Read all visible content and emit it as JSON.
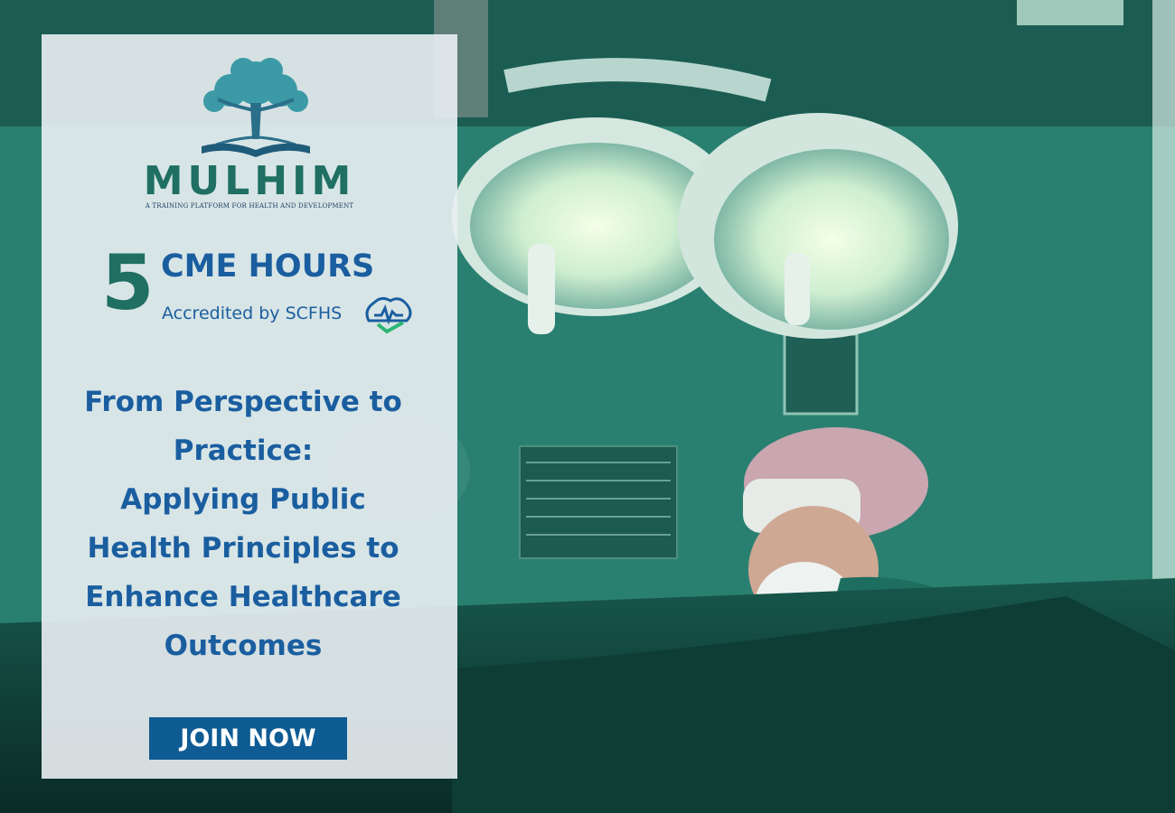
{
  "brand": {
    "name": "MULHIM",
    "tagline": "A TRAINING PLATFORM FOR HEALTH AND DEVELOPMENT"
  },
  "cme": {
    "number": "5",
    "label": "CME HOURS",
    "accreditation": "Accredited by SCFHS"
  },
  "course": {
    "title_lines": [
      "From Perspective to",
      "Practice:",
      "Applying Public",
      "Health Principles to",
      "Enhance Healthcare",
      "Outcomes"
    ]
  },
  "cta": {
    "label": "JOIN NOW"
  },
  "colors": {
    "brand_teal": "#1f6f63",
    "title_blue": "#1a5ea0",
    "button_blue": "#0f5b93",
    "scene_green": "#247a6a"
  },
  "icons": [
    "tree-book-logo-icon",
    "scfhs-logo-icon"
  ]
}
